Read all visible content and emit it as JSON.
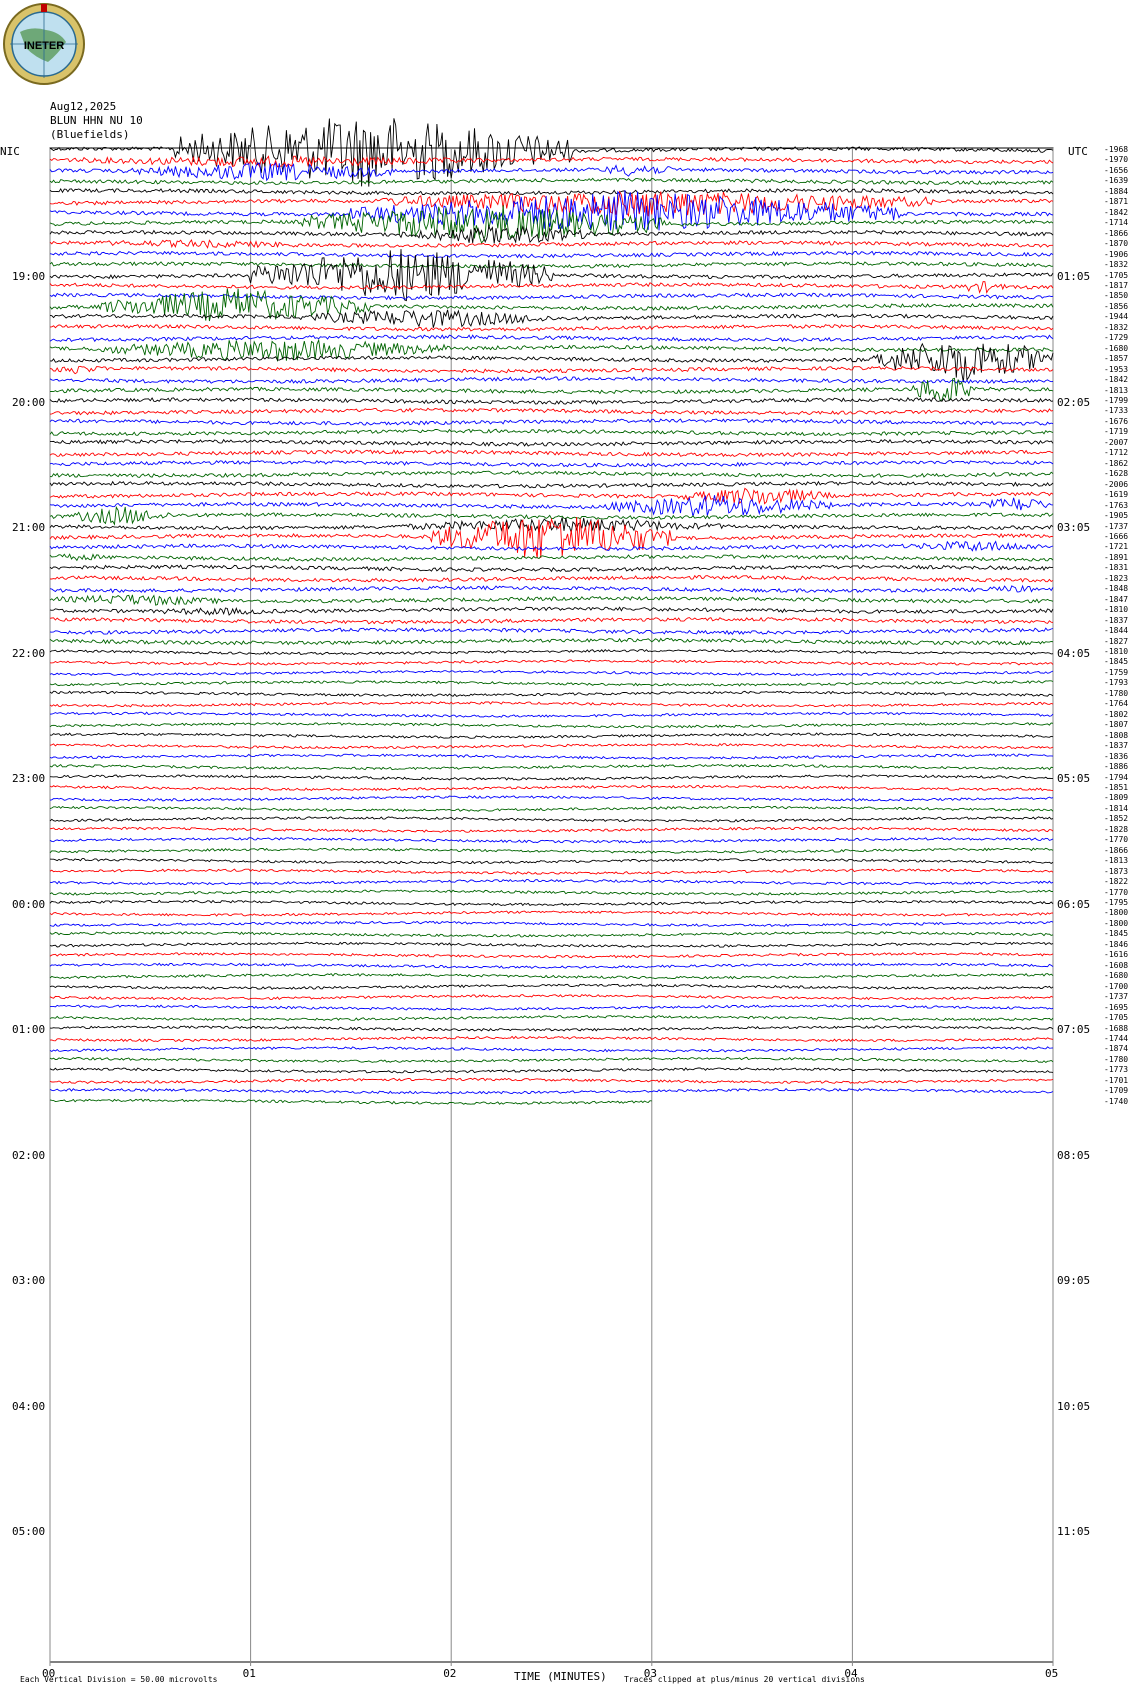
{
  "logo": {
    "text": "INETER"
  },
  "header": {
    "date": "Aug12,2025",
    "station": "BLUN HHN NU 10",
    "place": "(Bluefields)"
  },
  "labels": {
    "left_tz": "NIC",
    "right_tz": "UTC"
  },
  "colors": {
    "cycle": [
      "#000000",
      "#ff0000",
      "#0000ff",
      "#006400"
    ],
    "grid": "#888888"
  },
  "chart_data": {
    "type": "helicorder",
    "title": "",
    "xlabel": "TIME (MINUTES)",
    "xlim": [
      0,
      5
    ],
    "x_ticks": [
      "00",
      "01",
      "02",
      "03",
      "04",
      "05"
    ],
    "lines_per_hour": 12,
    "left_hour_labels": [
      "19:00",
      "20:00",
      "21:00",
      "22:00",
      "23:00",
      "00:00",
      "01:00",
      "02:00",
      "03:00",
      "04:00",
      "05:00"
    ],
    "right_hour_labels": [
      "01:05",
      "02:05",
      "03:05",
      "04:05",
      "05:05",
      "06:05",
      "07:05",
      "08:05",
      "09:05",
      "10:05",
      "11:05"
    ],
    "trace_mean_values": [
      "-1968",
      "-1970",
      "-1656",
      "-1639",
      "-1884",
      "-1871",
      "-1842",
      "-1714",
      "-1866",
      "-1870",
      "-1906",
      "-1832",
      "-1705",
      "-1817",
      "-1850",
      "-1856",
      "-1944",
      "-1832",
      "-1729",
      "-1680",
      "-1857",
      "-1953",
      "-1842",
      "-1813",
      "-1799",
      "-1733",
      "-1676",
      "-1719",
      "-2007",
      "-1712",
      "-1862",
      "-1628",
      "-2006",
      "-1619",
      "-1763",
      "-1905",
      "-1737",
      "-1666",
      "-1721",
      "-1891",
      "-1831",
      "-1823",
      "-1848",
      "-1847",
      "-1810",
      "-1837",
      "-1844",
      "-1827",
      "-1810",
      "-1845",
      "-1759",
      "-1793",
      "-1780",
      "-1764",
      "-1802",
      "-1807",
      "-1808",
      "-1837",
      "-1836",
      "-1886",
      "-1794",
      "-1851",
      "-1809",
      "-1814",
      "-1852",
      "-1828",
      "-1770",
      "-1866",
      "-1813",
      "-1873",
      "-1822",
      "-1770",
      "-1795",
      "-1800",
      "-1800",
      "-1845",
      "-1846",
      "-1616",
      "-1608",
      "-1680",
      "-1700",
      "-1737",
      "-1695",
      "-1705",
      "-1688",
      "-1744",
      "-1874",
      "-1780",
      "-1773",
      "-1701",
      "-1709",
      "-1740"
    ],
    "scale_note": "Each Vertical Division =    50.00 microvolts",
    "clip_note": "Traces clipped at plus/minus 20 vertical divisions"
  }
}
